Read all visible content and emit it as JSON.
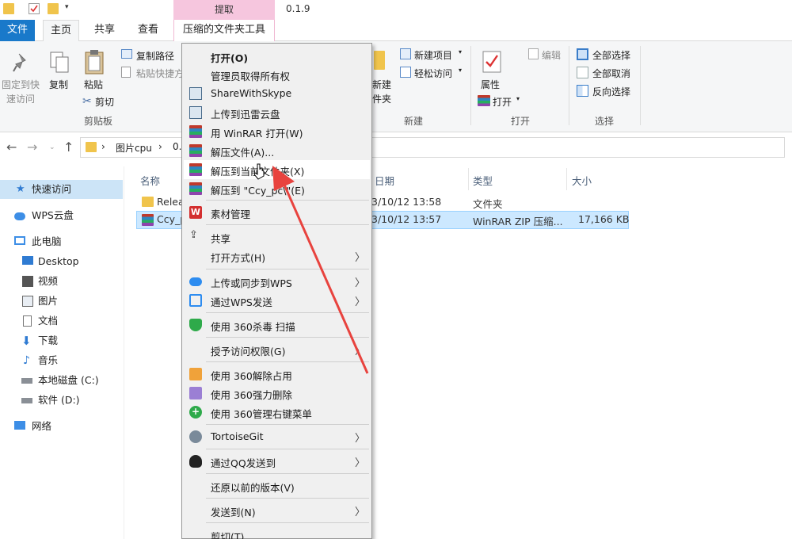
{
  "titlebar": {
    "context_tab_header": "提取",
    "version": "0.1.9"
  },
  "tabs": {
    "file": "文件",
    "home": "主页",
    "share": "共享",
    "view": "查看",
    "compressed_tools": "压缩的文件夹工具"
  },
  "ribbon": {
    "pin_quick_access": [
      "固定到快",
      "速访问"
    ],
    "copy": "复制",
    "paste": "粘贴",
    "copy_path": "复制路径",
    "paste_shortcut": "粘贴快捷方",
    "cut": "剪切",
    "clipboard_group": "剪贴板",
    "new_item": "新建项目",
    "easy_access": "轻松访问",
    "new_folder": [
      "新建",
      "件夹"
    ],
    "new_group": "新建",
    "properties": "属性",
    "open": "打开",
    "edit": "编辑",
    "open_group": "打开",
    "select_all": "全部选择",
    "select_none": "全部取消",
    "invert_selection": "反向选择",
    "select_group": "选择"
  },
  "address": {
    "crumb1": "图片cpu",
    "crumb2": "0."
  },
  "navpane": {
    "items": [
      {
        "label": "快速访问",
        "icon": "star-icon"
      },
      {
        "label": "WPS云盘",
        "icon": "cloud-icon"
      },
      {
        "label": "此电脑",
        "icon": "computer-icon"
      },
      {
        "label": "Desktop",
        "icon": "desktop-icon"
      },
      {
        "label": "视频",
        "icon": "video-icon"
      },
      {
        "label": "图片",
        "icon": "picture-icon"
      },
      {
        "label": "文档",
        "icon": "document-icon"
      },
      {
        "label": "下载",
        "icon": "download-icon"
      },
      {
        "label": "音乐",
        "icon": "music-icon"
      },
      {
        "label": "本地磁盘 (C:)",
        "icon": "drive-icon"
      },
      {
        "label": "软件 (D:)",
        "icon": "drive-icon"
      },
      {
        "label": "网络",
        "icon": "network-icon"
      }
    ]
  },
  "filelist": {
    "columns": {
      "name": "名称",
      "date": "日期",
      "type": "类型",
      "size": "大小"
    },
    "rows": [
      {
        "name": "Relea",
        "date": "3/10/12 13:58",
        "type": "文件夹",
        "size": ""
      },
      {
        "name": "Ccy_p",
        "date": "3/10/12 13:57",
        "type": "WinRAR ZIP 压缩...",
        "size": "17,166 KB"
      }
    ]
  },
  "context_menu": {
    "open": "打开(O)",
    "take_ownership": "管理员取得所有权",
    "share_with_skype": "ShareWithSkype",
    "upload_xunlei": "上传到迅雷云盘",
    "open_winrar": "用 WinRAR 打开(W)",
    "extract_files": "解压文件(A)...",
    "extract_here": "解压到当前文件夹(X)",
    "extract_to": "解压到 \"Ccy_pc\\\"(E)",
    "material_manage": "素材管理",
    "share": "共享",
    "open_with": "打开方式(H)",
    "wps_sync": "上传或同步到WPS",
    "wps_send": "通过WPS发送",
    "scan_360": "使用 360杀毒 扫描",
    "grant_access": "授予访问权限(G)",
    "unlock_360": "使用 360解除占用",
    "force_delete_360": "使用 360强力删除",
    "manage_menu_360": "使用 360管理右键菜单",
    "tortoisegit": "TortoiseGit",
    "qq_send": "通过QQ发送到",
    "restore_versions": "还原以前的版本(V)",
    "send_to": "发送到(N)",
    "cut": "剪切(T)"
  },
  "colors": {
    "file_tab": "#1979ca",
    "context_tab": "#f6c6de",
    "selection": "#cce8ff",
    "annotation_arrow": "#e8433e"
  }
}
